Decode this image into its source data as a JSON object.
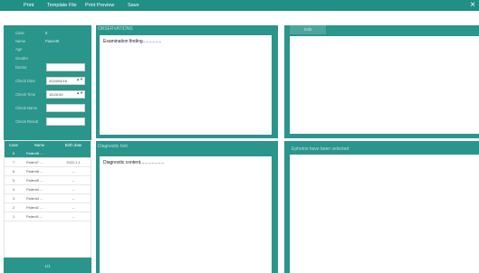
{
  "menu": {
    "print": "Print",
    "template_file": "Template File",
    "print_preview": "Print Preview",
    "save": "Save",
    "close_symbol": "×"
  },
  "patient_form": {
    "case_label": "Case",
    "case_value": "8",
    "name_label": "Name",
    "name_value": "Patient8",
    "age_label": "Age",
    "gender_label": "Gender",
    "doctor_label": "Doctor",
    "check_date_label": "Check Date",
    "check_date_value": "2024/04/15",
    "check_time_label": "Check Time",
    "check_time_value": "15:20:00",
    "check_name_label": "Check Name",
    "check_result_label": "Check Result",
    "spin_symbol": "▲▼"
  },
  "patient_table": {
    "headers": [
      "Case",
      "Name",
      "Birth date"
    ],
    "rows": [
      {
        "case": "8",
        "name": "Patient8 - -",
        "birth": ""
      },
      {
        "case": "7",
        "name": "Patient7 - -",
        "birth": "2022-1-1"
      },
      {
        "case": "6",
        "name": "Patient6 - -",
        "birth": "--"
      },
      {
        "case": "5",
        "name": "Patient5 - -",
        "birth": "--"
      },
      {
        "case": "4",
        "name": "Patient4 - -",
        "birth": "--"
      },
      {
        "case": "3",
        "name": "Patient3 - -",
        "birth": "--"
      },
      {
        "case": "2",
        "name": "Patient2 - -",
        "birth": "--"
      },
      {
        "case": "1",
        "name": "Patient1 - -",
        "birth": "--"
      }
    ],
    "selected_index": 0
  },
  "pager": {
    "label": "1/1"
  },
  "observations": {
    "title": "OBSERVATIONS",
    "text": "Examination finding..............."
  },
  "diagnostic": {
    "title": "Diagnostic hint",
    "text": "Diagnostic content..................."
  },
  "images": {
    "edit_label": "Edit",
    "selected_title": "Ephotos have been selected"
  },
  "colors": {
    "header": "#208f86",
    "panel": "#2a958b",
    "selected_row": "#2a958b"
  }
}
